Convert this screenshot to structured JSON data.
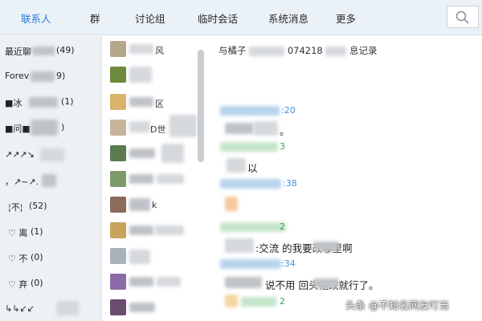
{
  "tabs": [
    {
      "label": "联系人",
      "active": true
    },
    {
      "label": "群",
      "active": false
    },
    {
      "label": "讨论组",
      "active": false
    },
    {
      "label": "临时会话",
      "active": false
    },
    {
      "label": "系统消息",
      "active": false
    },
    {
      "label": "更多",
      "active": false
    }
  ],
  "search": {
    "icon": "search-icon"
  },
  "left_list": [
    {
      "label": "最近聊",
      "count": "(49)"
    },
    {
      "label": "Forev",
      "count": "9)"
    },
    {
      "label": "■冰",
      "count": "(1)"
    },
    {
      "label": "■问■",
      "count": ")"
    },
    {
      "label": "↗↗↗↘",
      "count": ""
    },
    {
      "label": "，↗~↗.",
      "count": ""
    },
    {
      "label": "¦不¦",
      "count": "(52)"
    },
    {
      "label": "♡ 离",
      "count": "(1)"
    },
    {
      "label": "♡ 不",
      "count": "(0)"
    },
    {
      "label": "♡ 弃",
      "count": "(0)"
    },
    {
      "label": "↳↳↙↙",
      "count": ""
    }
  ],
  "member_list": [
    {
      "name": "风",
      "avatar_color": "#b5a78c"
    },
    {
      "name": "",
      "avatar_color": "#6c8a3c"
    },
    {
      "name": "区",
      "avatar_color": "#d9b46a"
    },
    {
      "name": "D世",
      "avatar_color": "#c7b49a"
    },
    {
      "name": "",
      "avatar_color": "#5b7a4f"
    },
    {
      "name": "",
      "avatar_color": "#7d9a6a"
    },
    {
      "name": "k",
      "avatar_color": "#8c6b5a"
    },
    {
      "name": "",
      "avatar_color": "#c9a35e"
    },
    {
      "name": "",
      "avatar_color": "#a8b2bc"
    },
    {
      "name": "",
      "avatar_color": "#8a6aa8"
    },
    {
      "name": "",
      "avatar_color": "#6a4c6f"
    }
  ],
  "chat": {
    "title_prefix": "与橘子",
    "title_mid": "074218",
    "title_suffix": "息记录",
    "lines": [
      {
        "kind": "time",
        "text": ":20"
      },
      {
        "kind": "body",
        "text": "。"
      },
      {
        "kind": "green",
        "text": "3"
      },
      {
        "kind": "body",
        "text": "以"
      },
      {
        "kind": "time",
        "text": ":38"
      },
      {
        "kind": "green",
        "text": "2"
      },
      {
        "kind": "body",
        "text": ":交流        的我要改哪里啊"
      },
      {
        "kind": "time",
        "text": ":34"
      },
      {
        "kind": "body",
        "text": "说不用        回头他改就行了。"
      },
      {
        "kind": "green",
        "text": "2"
      }
    ]
  },
  "watermark": "头条 @不知名网友叮当"
}
